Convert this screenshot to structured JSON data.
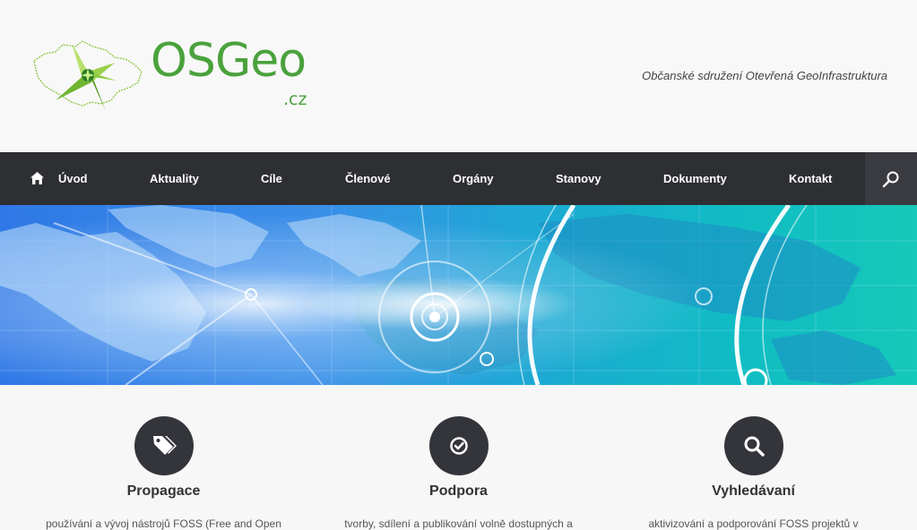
{
  "header": {
    "logo_text": "OSGeo",
    "logo_suffix": ".cz",
    "tagline": "Občanské sdružení Otevřená GeoInfrastruktura"
  },
  "nav": {
    "items": [
      {
        "label": "Úvod",
        "icon": "home-icon"
      },
      {
        "label": "Aktuality"
      },
      {
        "label": "Cíle"
      },
      {
        "label": "Členové"
      },
      {
        "label": "Orgány"
      },
      {
        "label": "Stanovy"
      },
      {
        "label": "Dokumenty"
      },
      {
        "label": "Kontakt"
      }
    ],
    "search_icon": "search-icon",
    "background": "#2e2f33"
  },
  "features": [
    {
      "title": "Propagace",
      "icon": "tags-icon",
      "text": "používání a vývoj nástrojů FOSS (Free and Open"
    },
    {
      "title": "Podpora",
      "icon": "check-circle-icon",
      "text": "tvorby, sdílení a publikování volně dostupných a"
    },
    {
      "title": "Vyhledávaní",
      "icon": "search-icon",
      "text": "aktivizování a podporování FOSS projektů v"
    }
  ],
  "colors": {
    "brand": "#4aa23c",
    "dark": "#34353a"
  }
}
